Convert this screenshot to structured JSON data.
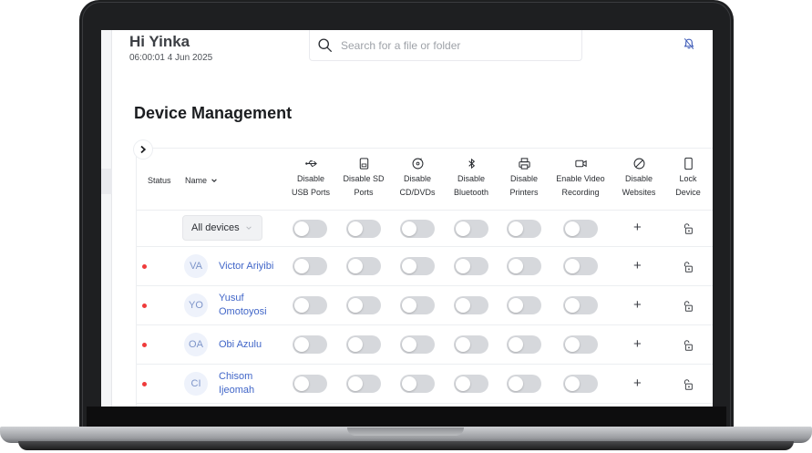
{
  "header": {
    "greeting": "Hi Yinka",
    "datetime": "06:00:01 4 Jun 2025",
    "search_placeholder": "Search for a file or folder"
  },
  "page": {
    "title": "Device Management"
  },
  "table": {
    "status_header": "Status",
    "name_header": "Name",
    "filter_label": "All devices",
    "columns": [
      {
        "key": "usb",
        "line1": "Disable",
        "line2": "USB Ports",
        "icon": "usb-icon"
      },
      {
        "key": "sd",
        "line1": "Disable SD",
        "line2": "Ports",
        "icon": "sd-card-icon"
      },
      {
        "key": "cd",
        "line1": "Disable",
        "line2": "CD/DVDs",
        "icon": "disc-icon"
      },
      {
        "key": "bt",
        "line1": "Disable",
        "line2": "Bluetooth",
        "icon": "bluetooth-icon"
      },
      {
        "key": "pr",
        "line1": "Disable",
        "line2": "Printers",
        "icon": "printer-icon"
      },
      {
        "key": "vr",
        "line1": "Enable Video",
        "line2": "Recording",
        "icon": "video-icon"
      },
      {
        "key": "web",
        "line1": "Disable",
        "line2": "Websites",
        "icon": "block-icon"
      },
      {
        "key": "lock",
        "line1": "Lock",
        "line2": "Device",
        "icon": "phone-icon"
      }
    ],
    "add_symbol": "+",
    "devices": [
      {
        "initials": "VA",
        "name": "Victor Ariyibi",
        "status_color": "#ef3b3b"
      },
      {
        "initials": "YO",
        "name": "Yusuf Omotoyosi",
        "status_color": "#ef3b3b"
      },
      {
        "initials": "OA",
        "name": "Obi Azulu",
        "status_color": "#ef3b3b"
      },
      {
        "initials": "CI",
        "name": "Chisom Ijeomah",
        "status_color": "#ef3b3b"
      }
    ]
  },
  "colors": {
    "accent": "#4166c8",
    "toggle_off": "#d6d8dc",
    "status_offline": "#ef3b3b"
  }
}
